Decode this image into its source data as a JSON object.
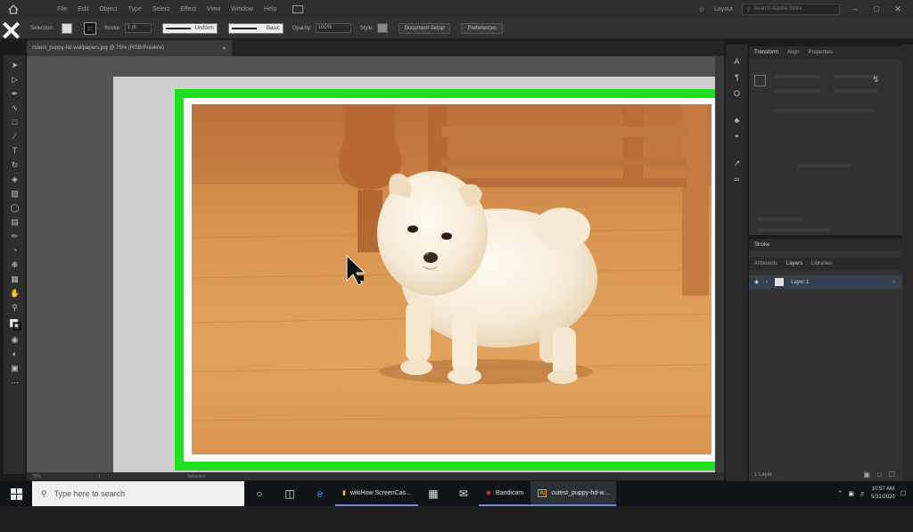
{
  "menubar": {
    "items": [
      "File",
      "Edit",
      "Object",
      "Type",
      "Select",
      "Effect",
      "View",
      "Window",
      "Help"
    ],
    "workspace": "Layout",
    "search_placeholder": "Search Adobe Stock"
  },
  "controlbar": {
    "selection_label": "Selection",
    "stroke_label": "Stroke:",
    "stroke_value": "1 pt",
    "brush1": "Uniform",
    "brush2": "Basic",
    "opacity_label": "Opacity:",
    "opacity_value": "100%",
    "style_label": "Style:",
    "document_setup": "Document Setup",
    "preferences": "Preferences"
  },
  "document": {
    "tab_title": "cutest_puppy-hd-wallpapers.jpg @ 75% (RGB/Preview)"
  },
  "statusbar": {
    "zoom": "75%",
    "page": "1",
    "tool": "Selection"
  },
  "panels": {
    "transform_tabs": [
      "Transform",
      "Align",
      "Properties"
    ],
    "layers_title": "Stroke",
    "layers_tabs": [
      "Artboards",
      "Layers",
      "Libraries"
    ],
    "layer_name": "Layer 1",
    "layers_count": "1 Layer"
  },
  "taskbar": {
    "search_placeholder": "Type here to search",
    "apps": [
      "wikiHow ScreenCas...",
      "Bandicam",
      "cutest_puppy-hd-w..."
    ],
    "time": "10:57 AM",
    "date": "5/31/2020"
  },
  "colors": {
    "highlight_frame": "#1ee01e",
    "app_bg": "#323232",
    "taskbar": "#101418"
  }
}
